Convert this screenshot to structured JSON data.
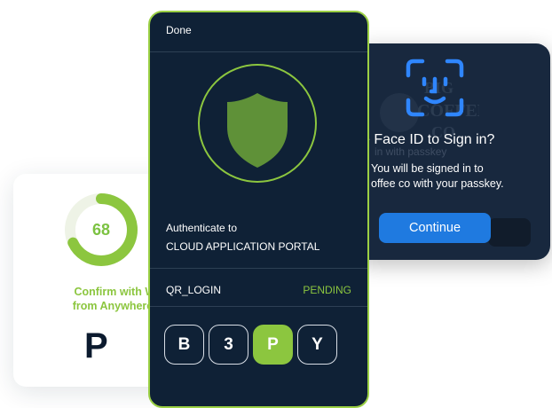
{
  "left_card": {
    "score": "68",
    "score_fraction": 0.68,
    "confirm_line1": "Confirm with Wo",
    "confirm_line2": "from Anywhere A",
    "logo_letter": "P",
    "accent_color": "#8cc63f"
  },
  "faceid_card": {
    "title": "e Face ID to Sign in?",
    "subtitle_line1": "You will be signed in to",
    "subtitle_line2": "offee co with your passkey.",
    "continue_label": "Continue",
    "ghost_logo_line1": "BIG",
    "ghost_logo_line2": "COFFEE",
    "ghost_logo_line3": "CO",
    "ghost_sub": "in with passkey",
    "button_color": "#1f7ae0",
    "icon": "face-id-icon"
  },
  "phone": {
    "header": "Done",
    "icon": "shield-icon",
    "auth_prefix": "Authenticate to",
    "app_name": "CLOUD APPLICATION PORTAL",
    "request_type": "QR_LOGIN",
    "status": "PENDING",
    "code": [
      "B",
      "3",
      "P",
      "Y"
    ],
    "highlight_color": "#8cc63f",
    "border_color": "#9bd044",
    "background_color": "#0f2136"
  }
}
